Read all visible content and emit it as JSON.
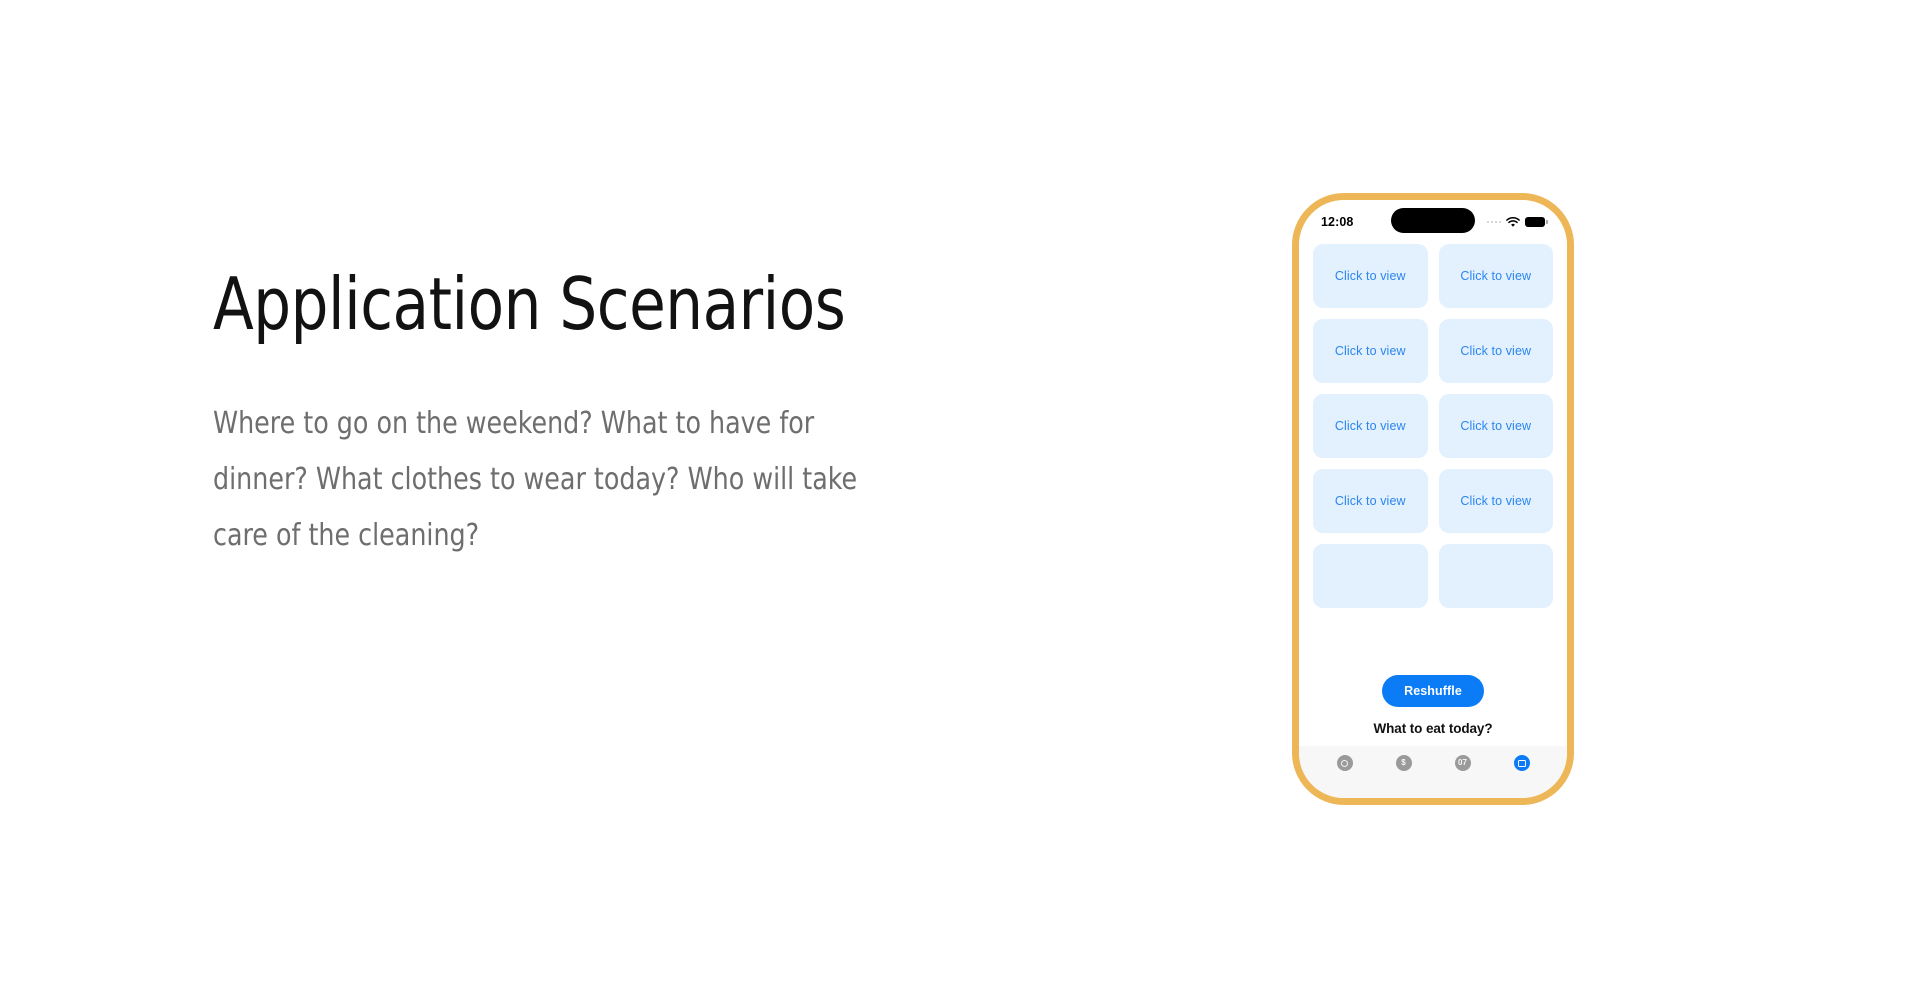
{
  "slide": {
    "title": "Application Scenarios",
    "subtitle": "Where to go on the weekend? What to have for dinner? What clothes to wear today? Who will take care of the cleaning?"
  },
  "colors": {
    "phone_frame": "#edb757",
    "tile_bg": "#e3f0fd",
    "tile_text": "#2a86f0",
    "accent_blue": "#0b7cf6",
    "tab_inactive": "#9a9a9a",
    "tab_bar_bg": "#f7f7f7",
    "title_text": "#121212",
    "subtitle_text": "#6e6e6e",
    "page_bg": "#ffffff"
  },
  "phone": {
    "status_bar": {
      "time": "12:08",
      "signal_icon": "signal-dots-icon",
      "wifi_icon": "wifi-icon",
      "battery_icon": "battery-icon",
      "dynamic_island": "dynamic-island"
    },
    "cards": [
      {
        "label": "Click to view"
      },
      {
        "label": "Click to view"
      },
      {
        "label": "Click to view"
      },
      {
        "label": "Click to view"
      },
      {
        "label": "Click to view"
      },
      {
        "label": "Click to view"
      },
      {
        "label": "Click to view"
      },
      {
        "label": "Click to view"
      },
      {
        "label": ""
      },
      {
        "label": ""
      }
    ],
    "actions": {
      "reshuffle_label": "Reshuffle",
      "prompt": "What to eat today?"
    },
    "tab_bar": {
      "items": [
        {
          "icon": "record-circle-icon",
          "glyph": "",
          "label": "",
          "active": false
        },
        {
          "icon": "dollar-circle-icon",
          "glyph": "$",
          "label": "",
          "active": false
        },
        {
          "icon": "calendar-day-icon",
          "glyph": "07",
          "label": "",
          "active": false
        },
        {
          "icon": "document-card-icon",
          "glyph": "",
          "label": "",
          "active": true
        }
      ]
    },
    "home_indicator": "home-indicator"
  }
}
